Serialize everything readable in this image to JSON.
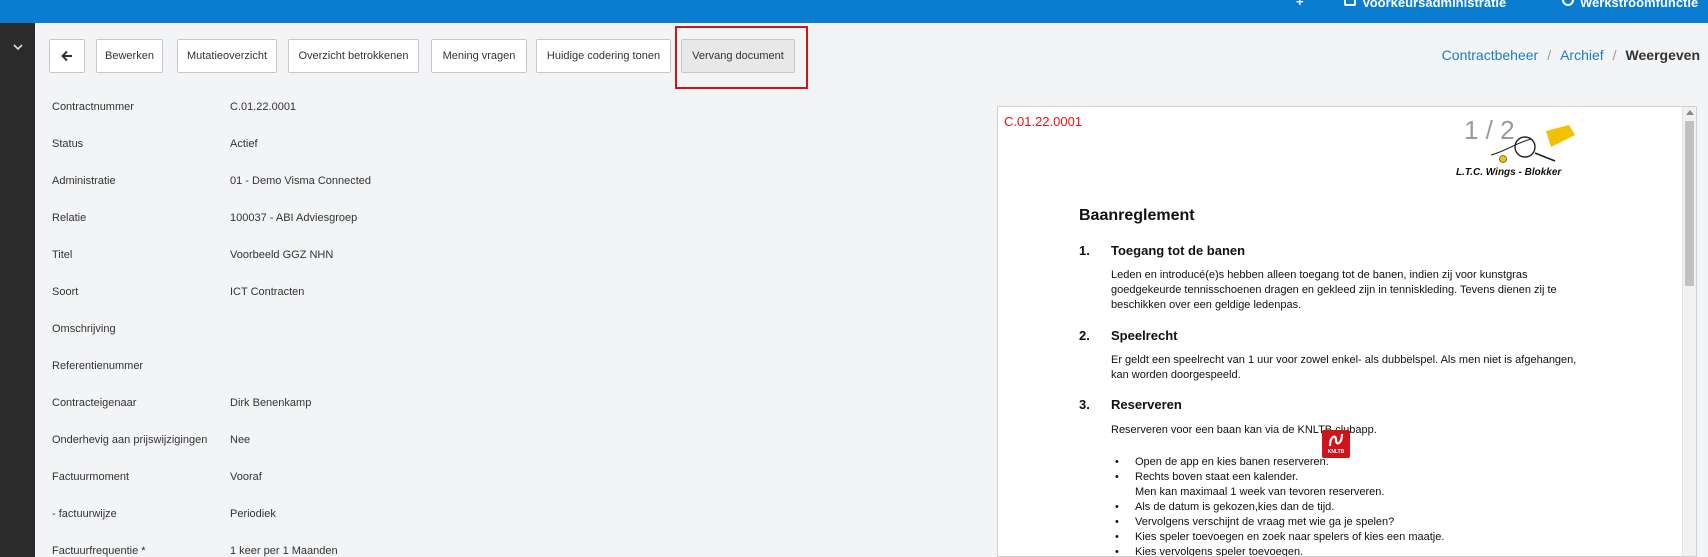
{
  "topbar": {
    "items": [
      {
        "label": "Voorkeursadministratie"
      },
      {
        "label": "Werkstroomfunctie"
      }
    ]
  },
  "toolbar": {
    "back_icon": "arrow-left-icon",
    "buttons": [
      {
        "label": "Bewerken"
      },
      {
        "label": "Mutatieoverzicht"
      },
      {
        "label": "Overzicht betrokkenen"
      },
      {
        "label": "Mening vragen"
      },
      {
        "label": "Huidige codering tonen"
      },
      {
        "label": "Vervang document"
      }
    ]
  },
  "breadcrumb": {
    "items": [
      "Contractbeheer",
      "Archief"
    ],
    "current": "Weergeven"
  },
  "fields": [
    {
      "label": "Contractnummer",
      "value": "C.01.22.0001"
    },
    {
      "label": "Status",
      "value": "Actief"
    },
    {
      "label": "Administratie",
      "value": "01 - Demo Visma Connected"
    },
    {
      "label": "Relatie",
      "value": "100037 - ABI Adviesgroep"
    },
    {
      "label": "Titel",
      "value": "Voorbeeld GGZ NHN"
    },
    {
      "label": "Soort",
      "value": "ICT Contracten"
    },
    {
      "label": "Omschrijving",
      "value": ""
    },
    {
      "label": "Referentienummer",
      "value": ""
    },
    {
      "label": "Contracteigenaar",
      "value": "Dirk Benenkamp"
    },
    {
      "label": "Onderhevig aan prijswijzigingen",
      "value": "Nee"
    },
    {
      "label": "Factuurmoment",
      "value": "Vooraf"
    },
    {
      "label": "- factuurwijze",
      "value": "Periodiek"
    },
    {
      "label": "Factuurfrequentie *",
      "value": "1 keer per 1 Maanden"
    }
  ],
  "document": {
    "doc_id": "C.01.22.0001",
    "page_counter": "1 / 2",
    "logo_text": "L.T.C. Wings - Blokker",
    "title": "Baanreglement",
    "sections": [
      {
        "num": "1.",
        "heading": "Toegang tot de banen",
        "lines": [
          "Leden en introducé(e)s hebben alleen toegang tot de banen, indien zij voor kunstgras",
          "goedgekeurde tennisschoenen dragen en gekleed zijn in tenniskleding. Tevens dienen zij te",
          "beschikken over een geldige ledenpas."
        ]
      },
      {
        "num": "2.",
        "heading": "Speelrecht",
        "lines": [
          "Er geldt een speelrecht van 1 uur voor zowel enkel- als dubbelspel. Als men niet is afgehangen,",
          "kan worden doorgespeeld."
        ]
      },
      {
        "num": "3.",
        "heading": "Reserveren",
        "lines": [
          "Reserveren voor een baan kan via de KNLTB clubapp."
        ]
      }
    ],
    "bullets": [
      "Open de app en kies banen reserveren.",
      "Rechts boven staat een kalender.",
      "Men kan maximaal 1 week van tevoren reserveren.",
      "Als de datum is gekozen,kies dan de tijd.",
      "Vervolgens verschijnt de vraag met wie ga je spelen?",
      "Kies speler toevoegen en zoek naar spelers of kies een maatje.",
      "Kies vervolgens speler toevoegen."
    ],
    "knltb_label": "KNLTB"
  },
  "colors": {
    "topbar": "#0a7dd0",
    "rail": "#2b2b2b",
    "link": "#1a7cc1",
    "highlight": "#d0121b",
    "doc_id": "#e11111"
  }
}
